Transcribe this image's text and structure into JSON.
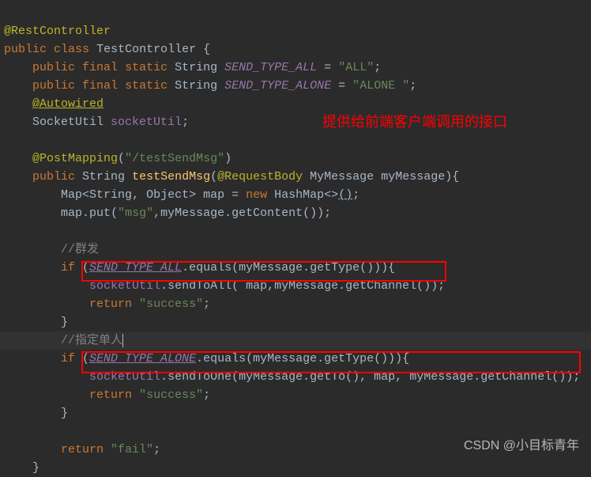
{
  "annotation_overlay": "提供给前端客户端调用的接口",
  "watermark": "CSDN @小目标青年",
  "code": {
    "rest_controller": "@RestController",
    "public": "public",
    "class": "class",
    "testcontroller": "TestController",
    "final": "final",
    "static": "static",
    "string_type": "String",
    "send_type_all_field": "SEND_TYPE_ALL",
    "all_val": "\"ALL\"",
    "send_type_alone_field": "SEND_TYPE_ALONE",
    "alone_val": "\"ALONE \"",
    "autowired": "@Autowired",
    "socketutil_type": "SocketUtil",
    "socketutil_field": "socketUtil",
    "postmapping": "@PostMapping",
    "postmapping_val": "\"/testSendMsg\"",
    "requestbody": "@RequestBody",
    "testsendmsg": "testSendMsg",
    "mymessage_type": "MyMessage",
    "mymessage_param": "myMessage",
    "map_type": "Map",
    "string_gen": "String",
    "object_gen": "Object",
    "map_var": "map",
    "new": "new",
    "hashmap": "HashMap",
    "put": "put",
    "msg_key": "\"msg\"",
    "getcontent": "getContent",
    "comment_qunfa": "//群发",
    "if": "if",
    "equals": "equals",
    "gettype": "getType",
    "sendtoall": "sendToAll",
    "getchannel": "getChannel",
    "return": "return",
    "success": "\"success\"",
    "comment_zhiding": "//指定单人",
    "sendtoone": "sendToOne",
    "getto": "getTo",
    "fail": "\"fail\""
  }
}
